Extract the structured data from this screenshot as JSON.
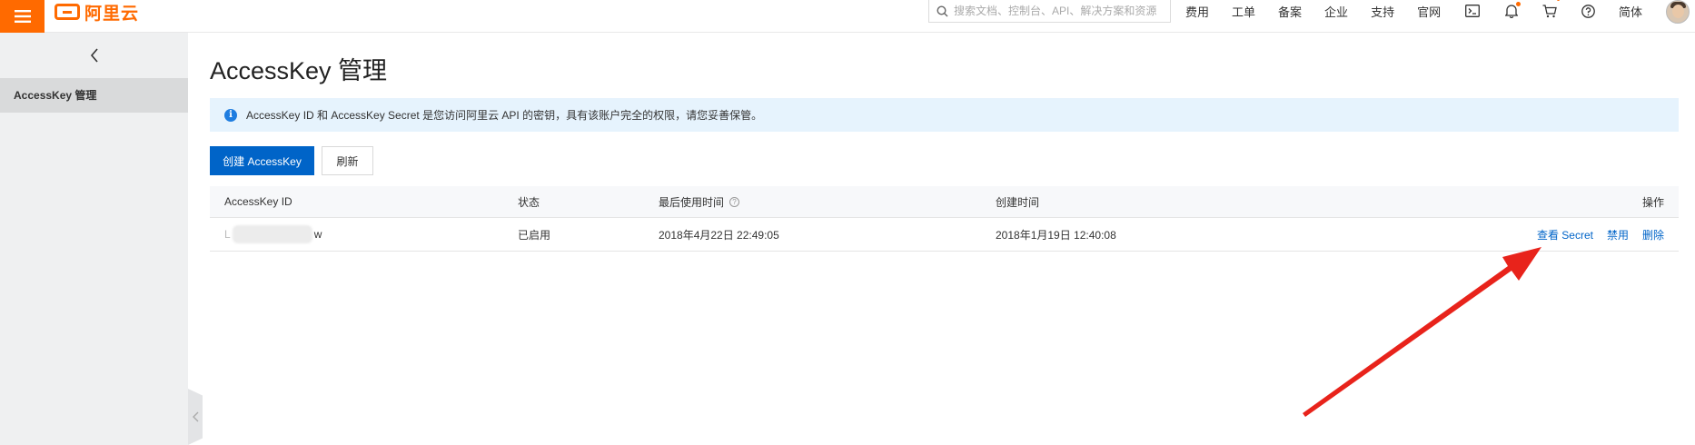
{
  "topbar": {
    "brand": "阿里云",
    "search_placeholder": "搜索文档、控制台、API、解决方案和资源",
    "nav": [
      "费用",
      "工单",
      "备案",
      "企业",
      "支持",
      "官网"
    ],
    "icons": [
      "terminal-icon",
      "bell-icon",
      "cart-icon",
      "help-icon"
    ],
    "lang": "简体",
    "accent": "#ff6a00"
  },
  "sidebar": {
    "items": [
      {
        "label": "AccessKey 管理"
      }
    ]
  },
  "main": {
    "title": "AccessKey 管理",
    "notice": "AccessKey ID 和 AccessKey Secret 是您访问阿里云 API 的密钥，具有该账户完全的权限，请您妥善保管。",
    "create_button": "创建 AccessKey",
    "refresh_button": "刷新",
    "table": {
      "headers": {
        "id": "AccessKey ID",
        "status": "状态",
        "last_used": "最后使用时间",
        "created": "创建时间",
        "actions": "操作"
      },
      "rows": [
        {
          "id_prefix": "L",
          "id_suffix": "w",
          "status": "已启用",
          "last_used": "2018年4月22日 22:49:05",
          "created": "2018年1月19日 12:40:08",
          "actions": {
            "view": "查看 Secret",
            "disable": "禁用",
            "delete": "删除"
          }
        }
      ]
    }
  },
  "colors": {
    "primary": "#0064c8",
    "notice_bg": "#e6f3fd",
    "annotation_arrow": "#e8231b"
  }
}
